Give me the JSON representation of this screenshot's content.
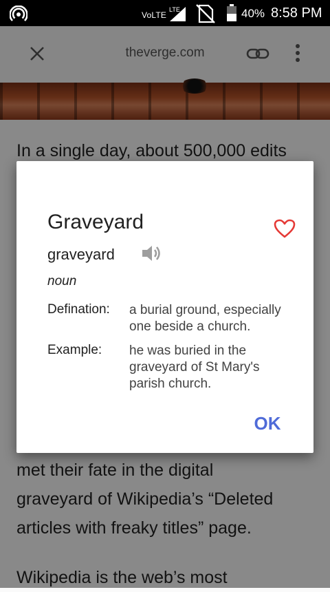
{
  "status_bar": {
    "network_label": "VoLTE",
    "signal_label": "LTE",
    "battery": "40%",
    "time": "8:58 PM",
    "icons": [
      "hotspot-icon",
      "signal-icon",
      "no-sim-icon",
      "battery-icon"
    ]
  },
  "browser": {
    "url": "theverge.com",
    "icons": [
      "close-icon",
      "link-icon",
      "more-vert-icon"
    ]
  },
  "article": {
    "para1": "In a single day, about 500,000 edits",
    "para2_line1": "met their fate in the digital",
    "para2_line2": "graveyard of Wikipedia’s “Deleted",
    "para2_line3": "articles with freaky titles” page.",
    "para3": "Wikipedia is the web’s most"
  },
  "dialog": {
    "word": "Graveyard",
    "pronunciation": "graveyard",
    "part_of_speech": "noun",
    "definition_label": "Defination:",
    "definition_line1": "a burial ground, especially",
    "definition_line2": "one beside a church.",
    "example_label": "Example:",
    "example_line1": "he was buried in the",
    "example_line2": "graveyard of St Mary's",
    "example_line3": "parish church.",
    "ok_label": "OK",
    "heart_color": "#e53935",
    "accent_color": "#4f6bd8"
  }
}
